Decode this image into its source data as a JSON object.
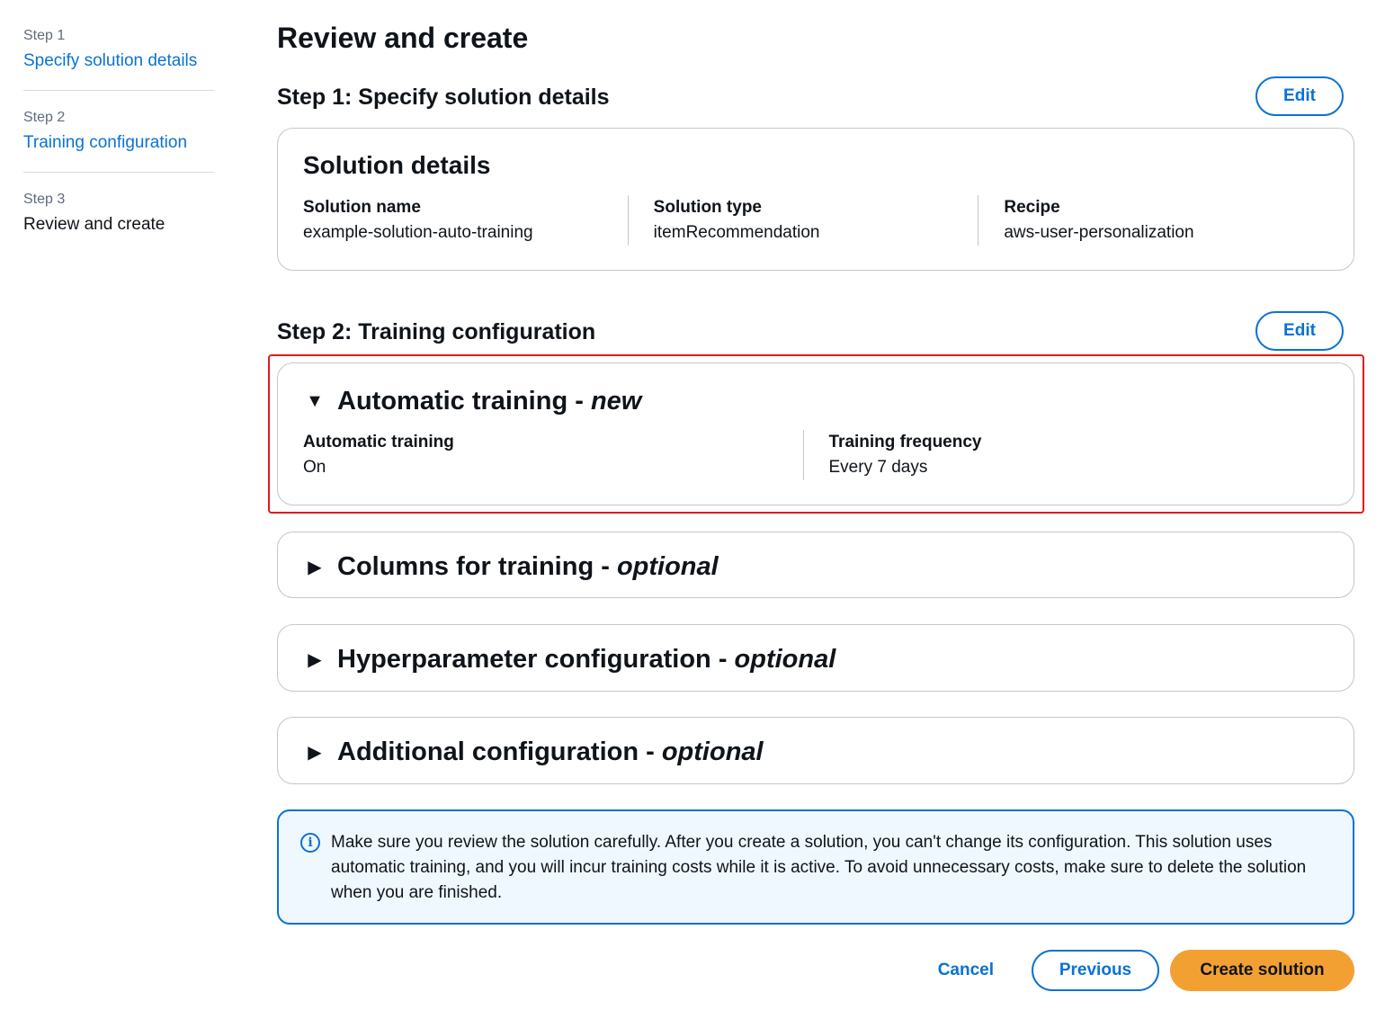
{
  "nav": {
    "steps": [
      {
        "number": "Step 1",
        "title": "Specify solution details"
      },
      {
        "number": "Step 2",
        "title": "Training configuration"
      },
      {
        "number": "Step 3",
        "title": "Review and create"
      }
    ]
  },
  "page": {
    "title": "Review and create"
  },
  "step1": {
    "heading": "Step 1: Specify solution details",
    "edit_label": "Edit",
    "card_title": "Solution details",
    "fields": [
      {
        "label": "Solution name",
        "value": "example-solution-auto-training"
      },
      {
        "label": "Solution type",
        "value": "itemRecommendation"
      },
      {
        "label": "Recipe",
        "value": "aws-user-personalization"
      }
    ]
  },
  "step2": {
    "heading": "Step 2: Training configuration",
    "edit_label": "Edit",
    "auto_training": {
      "title": "Automatic training - ",
      "title_suffix": "new",
      "expanded": true,
      "fields": [
        {
          "label": "Automatic training",
          "value": "On"
        },
        {
          "label": "Training frequency",
          "value": "Every 7 days"
        }
      ]
    },
    "sections": [
      {
        "title": "Columns for training - ",
        "suffix": "optional",
        "expanded": false
      },
      {
        "title": "Hyperparameter configuration - ",
        "suffix": "optional",
        "expanded": false
      },
      {
        "title": "Additional configuration - ",
        "suffix": "optional",
        "expanded": false
      }
    ]
  },
  "alert": {
    "icon": "info-icon",
    "text": "Make sure you review the solution carefully. After you create a solution, you can't change its configuration. This solution uses automatic training, and you will incur training costs while it is active. To avoid unnecessary costs, make sure to delete the solution when you are finished."
  },
  "footer": {
    "cancel_label": "Cancel",
    "previous_label": "Previous",
    "create_label": "Create solution"
  },
  "colors": {
    "link": "#0972d3",
    "primary_button": "#f3a033",
    "highlight": "#e0191e",
    "alert_bg": "#f0f8ff"
  }
}
